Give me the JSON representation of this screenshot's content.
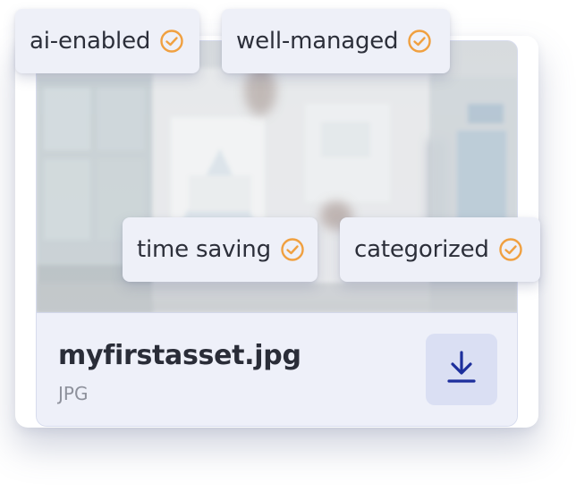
{
  "asset": {
    "file_name": "myfirstasset.jpg",
    "file_type": "JPG"
  },
  "tags": [
    {
      "label": "ai-enabled",
      "icon": "check-circle-icon"
    },
    {
      "label": "well-managed",
      "icon": "check-circle-icon"
    },
    {
      "label": "time saving",
      "icon": "check-circle-icon"
    },
    {
      "label": "categorized",
      "icon": "check-circle-icon"
    }
  ],
  "download": {
    "icon": "download-icon"
  },
  "colors": {
    "accent": "#1d2f9c",
    "check": "#f0a040",
    "card_bg": "#eef0f8",
    "button_bg": "#dadff3"
  }
}
